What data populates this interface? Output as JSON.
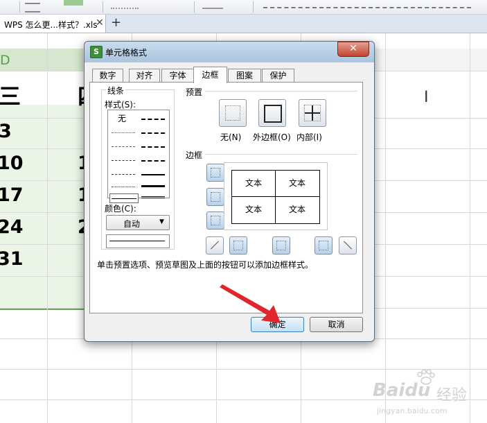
{
  "tab_bar": {
    "doc_tab_label": "WPS 怎么更...样式？.xls",
    "close_glyph": "✕",
    "new_tab_glyph": "+"
  },
  "sheet": {
    "column_d_label": "D",
    "header_row": [
      "三",
      "四"
    ],
    "rows": [
      [
        "3",
        ""
      ],
      [
        "10",
        "1"
      ],
      [
        "17",
        "1"
      ],
      [
        "24",
        "2"
      ],
      [
        "31",
        ""
      ]
    ]
  },
  "dialog": {
    "title": "单元格格式",
    "app_icon_glyph": "S",
    "close_glyph": "✕",
    "tabs": [
      {
        "label": "数字",
        "active": false
      },
      {
        "label": "对齐",
        "active": false
      },
      {
        "label": "字体",
        "active": false
      },
      {
        "label": "边框",
        "active": true
      },
      {
        "label": "图案",
        "active": false
      },
      {
        "label": "保护",
        "active": false
      }
    ],
    "line_group": {
      "title": "线条",
      "style_label": "样式(S):",
      "none_label": "无",
      "color_label": "颜色(C):",
      "color_value": "自动",
      "dropdown_glyph": "▼"
    },
    "preset": {
      "title": "预置",
      "items": [
        {
          "label": "无(N)"
        },
        {
          "label": "外边框(O)"
        },
        {
          "label": "内部(I)"
        }
      ]
    },
    "border": {
      "title": "边框",
      "preview_cells": [
        "文本",
        "文本",
        "文本",
        "文本"
      ]
    },
    "hint": "单击预置选项、预览草图及上面的按钮可以添加边框样式。",
    "ok_label": "确定",
    "cancel_label": "取消"
  },
  "watermark": {
    "brand": "Baidu",
    "suffix": "经验",
    "url": "jingyan.baidu.com"
  },
  "colors": {
    "accent_green": "#5a9a49",
    "selection_fill": "#eaf5e6",
    "arrow_red": "#e0262b",
    "title_bar": "#b6cde4"
  }
}
